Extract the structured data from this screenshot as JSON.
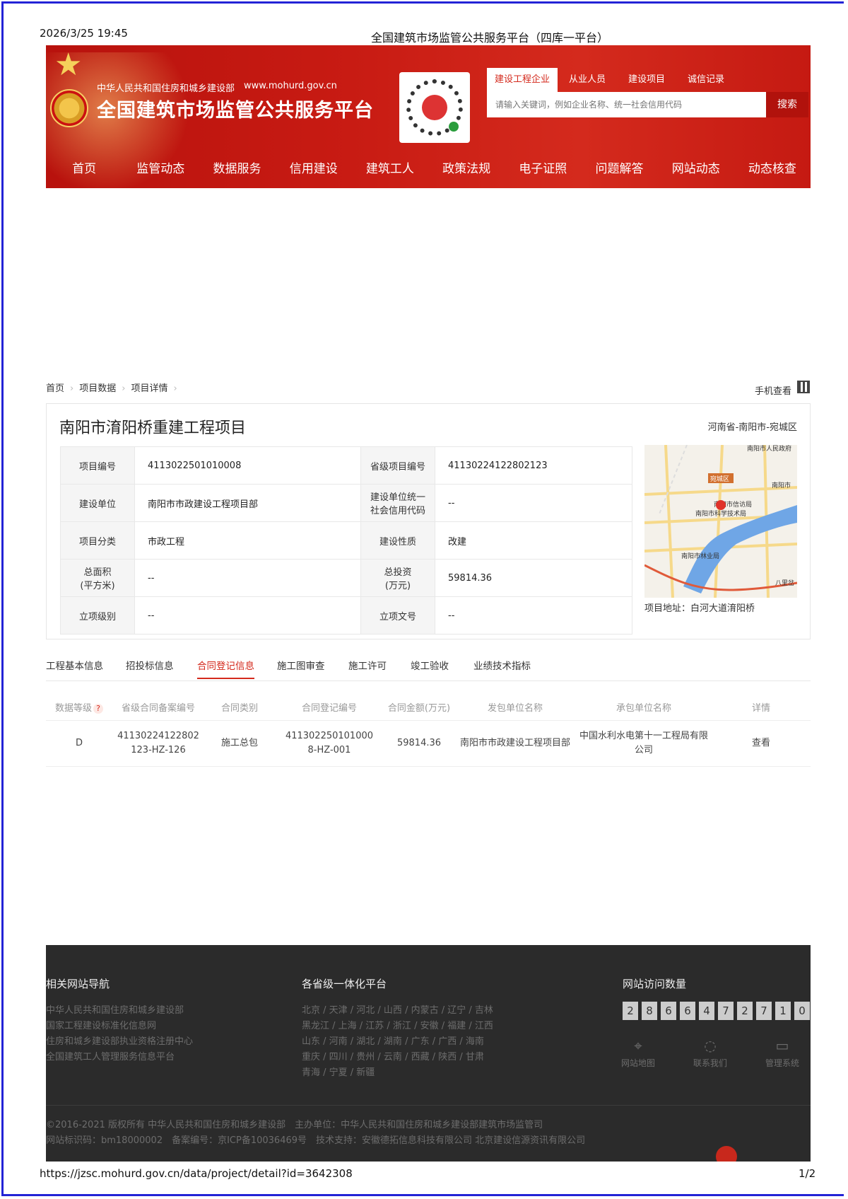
{
  "print": {
    "date": "2026/3/25 19:45",
    "title": "全国建筑市场监管公共服务平台（四库一平台）",
    "url": "https://jzsc.mohurd.gov.cn/data/project/detail?id=3642308",
    "page": "1/2"
  },
  "header": {
    "ministry": "中华人民共和国住房和城乡建设部",
    "site_url": "www.mohurd.gov.cn",
    "site_name": "全国建筑市场监管公共服务平台",
    "search_tabs": [
      "建设工程企业",
      "从业人员",
      "建设项目",
      "诚信记录"
    ],
    "search_placeholder": "请输入关键词，例如企业名称、统一社会信用代码",
    "search_button": "搜索",
    "nav": [
      "首页",
      "监管动态",
      "数据服务",
      "信用建设",
      "建筑工人",
      "政策法规",
      "电子证照",
      "问题解答",
      "网站动态",
      "动态核查"
    ]
  },
  "breadcrumb": [
    "首页",
    "项目数据",
    "项目详情"
  ],
  "mobile_view": "手机查看",
  "project": {
    "title": "南阳市淯阳桥重建工程项目",
    "region": "河南省-南阳市-宛城区",
    "fields": {
      "proj_no_label": "项目编号",
      "proj_no": "4113022501010008",
      "prov_no_label": "省级项目编号",
      "prov_no": "41130224122802123",
      "builder_label": "建设单位",
      "builder": "南阳市市政建设工程项目部",
      "credit_label_1": "建设单位统一",
      "credit_label_2": "社会信用代码",
      "credit": "--",
      "category_label": "项目分类",
      "category": "市政工程",
      "nature_label": "建设性质",
      "nature": "改建",
      "area_label_1": "总面积",
      "area_label_2": "(平方米)",
      "area": "--",
      "invest_label_1": "总投资",
      "invest_label_2": "(万元)",
      "invest": "59814.36",
      "level_label": "立项级别",
      "level": "--",
      "doc_label": "立项文号",
      "doc": "--"
    },
    "map_labels": [
      "南阳市人民政府",
      "宛城区",
      "南阳市",
      "南阳市信访局",
      "南阳市科学技术局",
      "南阳市林业局",
      "八里岔"
    ],
    "address": "项目地址：白河大道淯阳桥"
  },
  "tabs": [
    "工程基本信息",
    "招投标信息",
    "合同登记信息",
    "施工图审查",
    "施工许可",
    "竣工验收",
    "业绩技术指标"
  ],
  "contract_table": {
    "headers": [
      "数据等级",
      "省级合同备案编号",
      "合同类别",
      "合同登记编号",
      "合同金额(万元)",
      "发包单位名称",
      "承包单位名称",
      "详情"
    ],
    "help_mark": "?",
    "row": {
      "grade": "D",
      "prov_no_1": "41130224122802",
      "prov_no_2": "123-HZ-126",
      "type": "施工总包",
      "reg_no_1": "411302250101000",
      "reg_no_2": "8-HZ-001",
      "amount": "59814.36",
      "employer": "南阳市市政建设工程项目部",
      "contractor_1": "中国水利水电第十一工程局有限",
      "contractor_2": "公司",
      "detail": "查看"
    }
  },
  "footer": {
    "nav_title": "相关网站导航",
    "nav_links": [
      "中华人民共和国住房和城乡建设部",
      "国家工程建设标准化信息网",
      "住房和城乡建设部执业资格注册中心",
      "全国建筑工人管理服务信息平台"
    ],
    "prov_title": "各省级一体化平台",
    "prov_lines": [
      "北京 / 天津 / 河北 / 山西 / 内蒙古 / 辽宁 / 吉林",
      "黑龙江 / 上海 / 江苏 / 浙江 / 安徽 / 福建 / 江西",
      "山东 / 河南 / 湖北 / 湖南 / 广东 / 广西 / 海南",
      "重庆 / 四川 / 贵州 / 云南 / 西藏 / 陕西 / 甘肃",
      "青海 / 宁夏 / 新疆"
    ],
    "visits_title": "网站访问数量",
    "digits": [
      "2",
      "8",
      "6",
      "6",
      "4",
      "7",
      "2",
      "7",
      "1",
      "0"
    ],
    "icons": [
      "网站地图",
      "联系我们",
      "管理系统"
    ],
    "copyright": "©2016-2021 版权所有 中华人民共和国住房和城乡建设部　主办单位：中华人民共和国住房和城乡建设部建筑市场监管司",
    "icp": "网站标识码：bm18000002　备案编号：京ICP备10036469号　技术支持：安徽德拓信息科技有限公司 北京建设信源资讯有限公司"
  }
}
